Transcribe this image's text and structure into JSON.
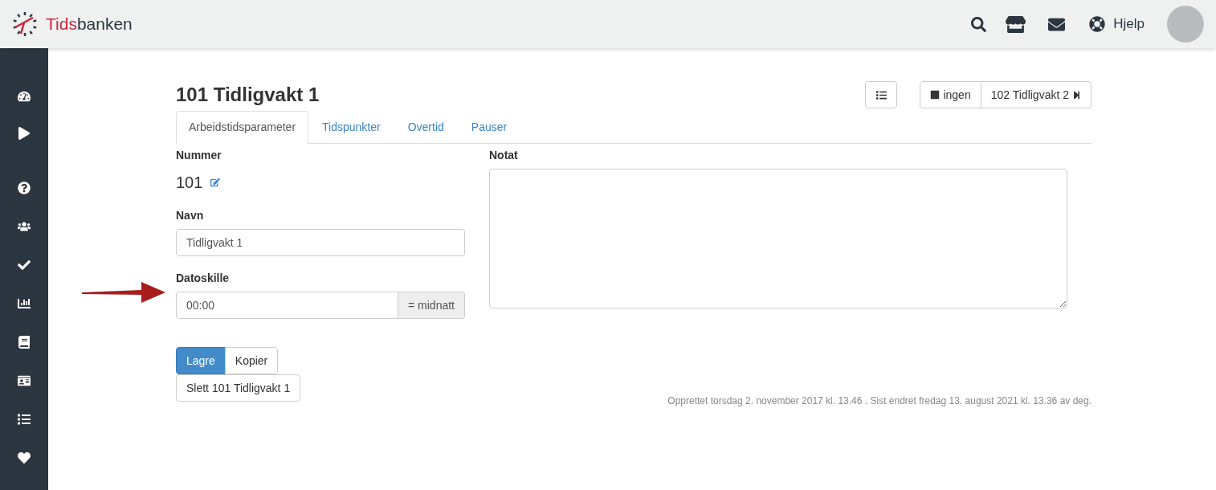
{
  "header": {
    "logo": {
      "accent": "Tids",
      "rest": "banken"
    },
    "help": "Hjelp"
  },
  "page": {
    "title": "101 Tidligvakt 1",
    "nav": {
      "previous": "ingen",
      "next": "102 Tidligvakt 2"
    }
  },
  "tabs": [
    {
      "label": "Arbeidstidsparameter",
      "selected": true
    },
    {
      "label": "Tidspunkter",
      "selected": false
    },
    {
      "label": "Overtid",
      "selected": false
    },
    {
      "label": "Pauser",
      "selected": false
    }
  ],
  "form": {
    "number_label": "Nummer",
    "number": "101",
    "name_label": "Navn",
    "name_value": "Tidligvakt 1",
    "date_label": "Datoskille",
    "date_value": "00:00",
    "date_addon": "= midnatt",
    "note_label": "Notat"
  },
  "buttons": [
    {
      "label": "Lagre",
      "kind": "primary"
    },
    {
      "label": "Kopier",
      "kind": "default"
    }
  ],
  "delete_button": "Slett 101 Tidligvakt 1",
  "footer_note": "Opprettet torsdag 2. november 2017 kl. 13.46 . Sist endret fredag 13. august 2021 kl. 13.36 av deg."
}
